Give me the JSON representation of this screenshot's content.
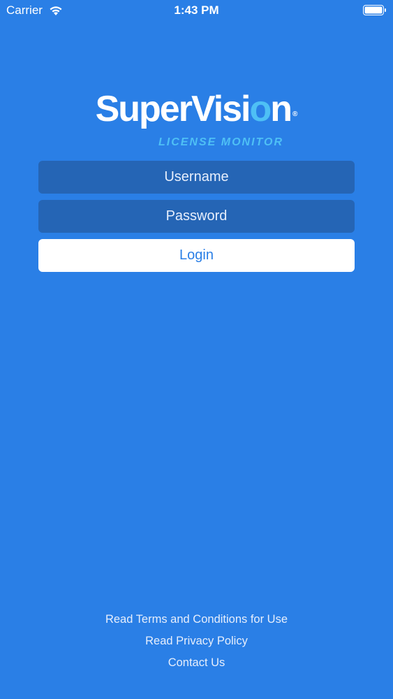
{
  "status_bar": {
    "carrier": "Carrier",
    "time": "1:43 PM",
    "wifi_icon": "wifi-icon",
    "battery_icon": "battery-icon"
  },
  "logo": {
    "wordmark_pre": "SuperVisi",
    "wordmark_o": "o",
    "wordmark_post": "n",
    "registered": "®",
    "subtitle": "LICENSE MONITOR"
  },
  "form": {
    "username_placeholder": "Username",
    "password_placeholder": "Password",
    "login_label": "Login"
  },
  "footer": {
    "terms_link": "Read Terms and Conditions for Use",
    "privacy_link": "Read Privacy Policy",
    "contact_link": "Contact Us"
  },
  "colors": {
    "background": "#2a7fe6",
    "field_background": "#2565b5",
    "accent": "#4ec0f5",
    "button_background": "#ffffff"
  }
}
